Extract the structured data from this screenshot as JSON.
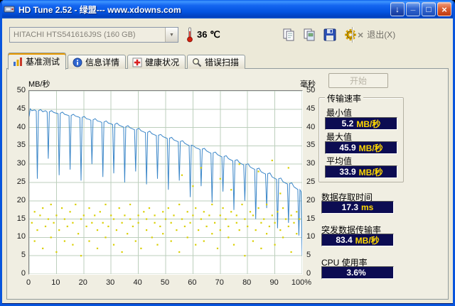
{
  "window": {
    "title": "HD Tune 2.52 - 绿盟--- www.xdowns.com"
  },
  "icons": {
    "download": "↓",
    "minimize": "_",
    "maximize": "□",
    "close": "×",
    "dropdown": "▼",
    "exit_x": "×"
  },
  "toolbar": {
    "drive": "HITACHI HTS541616J9S (160 GB)",
    "temperature": "36 ℃",
    "exit_label": "退出(X)"
  },
  "tabs": [
    {
      "label": "基准测试",
      "active": true
    },
    {
      "label": "信息详情",
      "active": false
    },
    {
      "label": "健康状况",
      "active": false
    },
    {
      "label": "错误扫描",
      "active": false
    }
  ],
  "panel": {
    "start_label": "开始"
  },
  "stats": {
    "group_title": "传输速率",
    "items": [
      {
        "label": "最小值",
        "value": "5.2",
        "unit": "MB/秒"
      },
      {
        "label": "最大值",
        "value": "45.9",
        "unit": "MB/秒"
      },
      {
        "label": "平均值",
        "value": "33.9",
        "unit": "MB/秒"
      }
    ],
    "extras": [
      {
        "label": "数据存取时间",
        "value": "17.3",
        "unit": "ms"
      },
      {
        "label": "突发数据传输率",
        "value": "83.4",
        "unit": "MB/秒"
      },
      {
        "label": "CPU 使用率",
        "value": "3.6%",
        "unit": ""
      }
    ]
  },
  "colors": {
    "value_box_bg": "#0c0c52",
    "value_text": "#ffffff",
    "unit_text": "#ffd800",
    "line": "#3a86c8",
    "scatter": "#d9cf00",
    "grid": "#bccfbc",
    "titlebar": "#0a55e0"
  },
  "chart_data": {
    "type": "line+scatter",
    "title": "HD Tune benchmark transfer rate and access time",
    "xlim": [
      0,
      100
    ],
    "ylim_left": [
      0,
      50
    ],
    "ylim_right": [
      0,
      50
    ],
    "y_left_label": "MB/秒",
    "y_right_label": "毫秒",
    "x_ticks": [
      "0",
      "10",
      "20",
      "30",
      "40",
      "50",
      "60",
      "70",
      "80",
      "90",
      "100%"
    ],
    "y_ticks_left": [
      "50",
      "45",
      "40",
      "35",
      "30",
      "25",
      "20",
      "15",
      "10",
      "5",
      "0"
    ],
    "y_ticks_right": [
      "50",
      "45",
      "40",
      "35",
      "30",
      "25",
      "20",
      "15",
      "10",
      "5",
      "0"
    ],
    "grid": true,
    "series": [
      {
        "name": "传输速率",
        "type": "line",
        "color": "#3a86c8",
        "points": [
          [
            0,
            43.0
          ],
          [
            0.4,
            45.1
          ],
          [
            1,
            44.6
          ],
          [
            2,
            44.8
          ],
          [
            2.6,
            44.5
          ],
          [
            3,
            26.0
          ],
          [
            3.4,
            44.6
          ],
          [
            4.2,
            44.9
          ],
          [
            5,
            44.3
          ],
          [
            6,
            44.6
          ],
          [
            6.6,
            44.2
          ],
          [
            7,
            31.5
          ],
          [
            7.4,
            44.3
          ],
          [
            8.2,
            44.6
          ],
          [
            9,
            44.1
          ],
          [
            10,
            43.9
          ],
          [
            10.6,
            43.8
          ],
          [
            11,
            27.0
          ],
          [
            11.4,
            43.9
          ],
          [
            12.2,
            44.2
          ],
          [
            13,
            43.6
          ],
          [
            14,
            43.4
          ],
          [
            14.6,
            43.2
          ],
          [
            15,
            28.5
          ],
          [
            15.4,
            43.3
          ],
          [
            16.2,
            43.6
          ],
          [
            17,
            43.1
          ],
          [
            18,
            42.9
          ],
          [
            18.6,
            42.7
          ],
          [
            19,
            25.5
          ],
          [
            19.4,
            42.8
          ],
          [
            20.2,
            43.0
          ],
          [
            21,
            42.4
          ],
          [
            22,
            42.2
          ],
          [
            22.6,
            42.0
          ],
          [
            23,
            30.0
          ],
          [
            23.4,
            42.1
          ],
          [
            24.2,
            42.4
          ],
          [
            25,
            41.8
          ],
          [
            26,
            41.6
          ],
          [
            26.6,
            41.4
          ],
          [
            27,
            26.5
          ],
          [
            27.4,
            41.5
          ],
          [
            28.2,
            41.8
          ],
          [
            29,
            41.2
          ],
          [
            30,
            41.0
          ],
          [
            30.6,
            40.8
          ],
          [
            31,
            27.5
          ],
          [
            31.4,
            40.9
          ],
          [
            32.2,
            41.2
          ],
          [
            33,
            40.6
          ],
          [
            34,
            40.3
          ],
          [
            34.6,
            40.1
          ],
          [
            35,
            25.0
          ],
          [
            35.4,
            40.2
          ],
          [
            36.2,
            40.5
          ],
          [
            37,
            39.9
          ],
          [
            38,
            39.6
          ],
          [
            38.6,
            39.4
          ],
          [
            39,
            28.0
          ],
          [
            39.4,
            39.5
          ],
          [
            40.2,
            39.8
          ],
          [
            41,
            39.1
          ],
          [
            42,
            38.8
          ],
          [
            42.6,
            38.6
          ],
          [
            43,
            24.5
          ],
          [
            43.4,
            38.7
          ],
          [
            44.2,
            39.0
          ],
          [
            45,
            38.3
          ],
          [
            46,
            38.0
          ],
          [
            46.6,
            37.8
          ],
          [
            47,
            26.0
          ],
          [
            47.4,
            37.9
          ],
          [
            48.2,
            38.1
          ],
          [
            49,
            37.5
          ],
          [
            50,
            37.2
          ],
          [
            50.6,
            37.0
          ],
          [
            51,
            23.0
          ],
          [
            51.4,
            37.1
          ],
          [
            52.2,
            37.3
          ],
          [
            53,
            36.6
          ],
          [
            54,
            36.3
          ],
          [
            54.6,
            36.1
          ],
          [
            55,
            25.5
          ],
          [
            55.4,
            36.2
          ],
          [
            56.2,
            36.4
          ],
          [
            57,
            35.7
          ],
          [
            58,
            35.3
          ],
          [
            58.6,
            35.1
          ],
          [
            59,
            21.0
          ],
          [
            59.4,
            35.2
          ],
          [
            60.2,
            35.0
          ],
          [
            61,
            34.5
          ],
          [
            62,
            34.2
          ],
          [
            62.6,
            34.0
          ],
          [
            63,
            24.0
          ],
          [
            63.4,
            34.1
          ],
          [
            64.2,
            34.3
          ],
          [
            65,
            33.6
          ],
          [
            66,
            33.2
          ],
          [
            66.6,
            33.0
          ],
          [
            67,
            19.5
          ],
          [
            67.4,
            33.1
          ],
          [
            68.2,
            33.3
          ],
          [
            69,
            32.6
          ],
          [
            70,
            32.2
          ],
          [
            70.6,
            32.0
          ],
          [
            71,
            22.5
          ],
          [
            71.4,
            32.1
          ],
          [
            72.2,
            32.3
          ],
          [
            73,
            31.5
          ],
          [
            74,
            31.1
          ],
          [
            74.6,
            30.9
          ],
          [
            75,
            17.5
          ],
          [
            75.4,
            31.0
          ],
          [
            76.2,
            31.2
          ],
          [
            77,
            30.4
          ],
          [
            78,
            30.0
          ],
          [
            78.6,
            29.8
          ],
          [
            79,
            20.0
          ],
          [
            79.4,
            29.9
          ],
          [
            80.2,
            30.1
          ],
          [
            81,
            29.2
          ],
          [
            82,
            28.8
          ],
          [
            82.6,
            28.6
          ],
          [
            83,
            15.0
          ],
          [
            83.4,
            28.7
          ],
          [
            84.2,
            28.9
          ],
          [
            85,
            27.9
          ],
          [
            86,
            27.5
          ],
          [
            86.6,
            27.3
          ],
          [
            87,
            18.0
          ],
          [
            87.4,
            27.4
          ],
          [
            88.2,
            27.6
          ],
          [
            89,
            26.5
          ],
          [
            90,
            26.1
          ],
          [
            90.6,
            25.9
          ],
          [
            91,
            12.5
          ],
          [
            91.4,
            26.0
          ],
          [
            92.2,
            26.2
          ],
          [
            93,
            25.2
          ],
          [
            94,
            24.8
          ],
          [
            94.6,
            24.6
          ],
          [
            95,
            14.0
          ],
          [
            95.4,
            24.7
          ],
          [
            96.2,
            24.9
          ],
          [
            97,
            23.8
          ],
          [
            98,
            23.3
          ],
          [
            98.4,
            23.1
          ],
          [
            98.8,
            10.5
          ],
          [
            99.2,
            23.0
          ],
          [
            99.6,
            22.5
          ],
          [
            100,
            5.0
          ]
        ]
      },
      {
        "name": "存取时间",
        "type": "scatter",
        "color": "#d9cf00",
        "points": [
          [
            1,
            14
          ],
          [
            2,
            9
          ],
          [
            2,
            17
          ],
          [
            3,
            12
          ],
          [
            4,
            16
          ],
          [
            5,
            7
          ],
          [
            5,
            18
          ],
          [
            6,
            13
          ],
          [
            7,
            15
          ],
          [
            8,
            10
          ],
          [
            8,
            19
          ],
          [
            9,
            14
          ],
          [
            10,
            6
          ],
          [
            10,
            16
          ],
          [
            11,
            12
          ],
          [
            12,
            18
          ],
          [
            13,
            9
          ],
          [
            13,
            15
          ],
          [
            14,
            13
          ],
          [
            15,
            17
          ],
          [
            16,
            8
          ],
          [
            16,
            14
          ],
          [
            17,
            19
          ],
          [
            18,
            11
          ],
          [
            19,
            15
          ],
          [
            19,
            5
          ],
          [
            20,
            16
          ],
          [
            21,
            13
          ],
          [
            22,
            18
          ],
          [
            22,
            9
          ],
          [
            23,
            14
          ],
          [
            24,
            16
          ],
          [
            25,
            7
          ],
          [
            25,
            12
          ],
          [
            26,
            17
          ],
          [
            27,
            14
          ],
          [
            28,
            10
          ],
          [
            28,
            19
          ],
          [
            29,
            13
          ],
          [
            30,
            16
          ],
          [
            31,
            8
          ],
          [
            31,
            15
          ],
          [
            32,
            12
          ],
          [
            33,
            18
          ],
          [
            34,
            14
          ],
          [
            34,
            6
          ],
          [
            35,
            16
          ],
          [
            36,
            11
          ],
          [
            37,
            15
          ],
          [
            37,
            19
          ],
          [
            38,
            13
          ],
          [
            39,
            9
          ],
          [
            40,
            16
          ],
          [
            40,
            14
          ],
          [
            41,
            7
          ],
          [
            42,
            17
          ],
          [
            43,
            12
          ],
          [
            43,
            15
          ],
          [
            44,
            18
          ],
          [
            45,
            10
          ],
          [
            46,
            14
          ],
          [
            46,
            16
          ],
          [
            47,
            8
          ],
          [
            48,
            13
          ],
          [
            49,
            17
          ],
          [
            49,
            11
          ],
          [
            50,
            15
          ],
          [
            51,
            18
          ],
          [
            52,
            9
          ],
          [
            52,
            14
          ],
          [
            53,
            16
          ],
          [
            54,
            12
          ],
          [
            55,
            19
          ],
          [
            55,
            6
          ],
          [
            56,
            15
          ],
          [
            57,
            13
          ],
          [
            58,
            17
          ],
          [
            58,
            10
          ],
          [
            59,
            14
          ],
          [
            60,
            16
          ],
          [
            61,
            8
          ],
          [
            61,
            18
          ],
          [
            62,
            12
          ],
          [
            63,
            15
          ],
          [
            64,
            9
          ],
          [
            64,
            17
          ],
          [
            65,
            13
          ],
          [
            66,
            16
          ],
          [
            67,
            11
          ],
          [
            67,
            19
          ],
          [
            68,
            14
          ],
          [
            69,
            7
          ],
          [
            70,
            16
          ],
          [
            70,
            12
          ],
          [
            71,
            18
          ],
          [
            72,
            15
          ],
          [
            73,
            10
          ],
          [
            73,
            13
          ],
          [
            74,
            17
          ],
          [
            75,
            8
          ],
          [
            76,
            14
          ],
          [
            76,
            16
          ],
          [
            77,
            12
          ],
          [
            78,
            19
          ],
          [
            79,
            15
          ],
          [
            79,
            5
          ],
          [
            80,
            13
          ],
          [
            81,
            17
          ],
          [
            82,
            9
          ],
          [
            82,
            16
          ],
          [
            83,
            12
          ],
          [
            84,
            18
          ],
          [
            85,
            14
          ],
          [
            85,
            7
          ],
          [
            86,
            15
          ],
          [
            87,
            11
          ],
          [
            87,
            19
          ],
          [
            88,
            13
          ],
          [
            89,
            16
          ],
          [
            90,
            8
          ],
          [
            90,
            14
          ],
          [
            91,
            17
          ],
          [
            92,
            12
          ],
          [
            93,
            18
          ],
          [
            93,
            10
          ],
          [
            94,
            15
          ],
          [
            95,
            13
          ],
          [
            96,
            16
          ],
          [
            96,
            6
          ],
          [
            97,
            14
          ],
          [
            98,
            11
          ],
          [
            98,
            17
          ],
          [
            99,
            15
          ],
          [
            56,
            27
          ],
          [
            63,
            29
          ],
          [
            70,
            26
          ],
          [
            77,
            30
          ],
          [
            84,
            28
          ],
          [
            89,
            31
          ],
          [
            95,
            29
          ],
          [
            60,
            24
          ],
          [
            74,
            23
          ],
          [
            92,
            22
          ]
        ]
      }
    ]
  }
}
